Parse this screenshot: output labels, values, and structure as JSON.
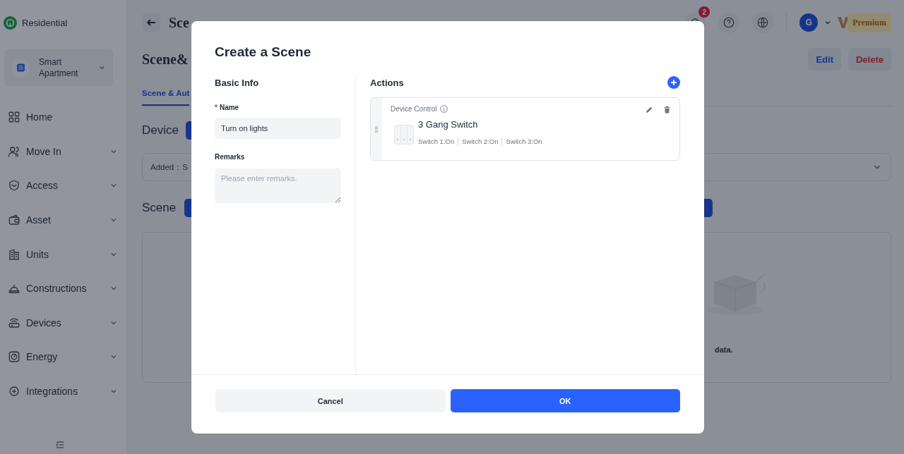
{
  "sidebar": {
    "brand": "Residential",
    "project": "Smart Apartment",
    "items": [
      {
        "label": "Home",
        "kind": "link"
      },
      {
        "label": "Move In",
        "kind": "group"
      },
      {
        "label": "Access",
        "kind": "group"
      },
      {
        "label": "Asset",
        "kind": "group"
      },
      {
        "label": "Units",
        "kind": "group"
      },
      {
        "label": "Constructions",
        "kind": "group"
      },
      {
        "label": "Devices",
        "kind": "group"
      },
      {
        "label": "Energy",
        "kind": "group"
      },
      {
        "label": "Integrations",
        "kind": "group"
      }
    ]
  },
  "header": {
    "title": "Sce",
    "notifications": "2",
    "avatar": "G",
    "plan": "Premium"
  },
  "page": {
    "heading": "Scene&",
    "actions": [
      {
        "label": "Edit",
        "kind": "primary"
      },
      {
        "label": "Delete",
        "kind": "danger"
      }
    ],
    "tabs": [
      {
        "label": "Scene & Aut",
        "selected": true
      }
    ],
    "device_section": {
      "title": "Device",
      "filter": "Added：S"
    },
    "scene_section": {
      "title": "Scene",
      "empty_text": "data."
    }
  },
  "dialog": {
    "title": "Create a Scene",
    "basic_info": {
      "heading": "Basic Info",
      "name_label": "Name",
      "required_mark": "*",
      "name_value": "Turn on lights",
      "remarks_label": "Remarks",
      "remarks_placeholder": "Please enter remarks."
    },
    "actions": {
      "heading": "Actions",
      "items": [
        {
          "type": "Device Control",
          "device": "3 Gang Switch",
          "states": [
            "Switch 1:On",
            "Switch 2:On",
            "Switch 3:On"
          ]
        }
      ]
    },
    "buttons": [
      {
        "label": "Cancel",
        "kind": "secondary"
      },
      {
        "label": "OK",
        "kind": "primary"
      }
    ]
  }
}
